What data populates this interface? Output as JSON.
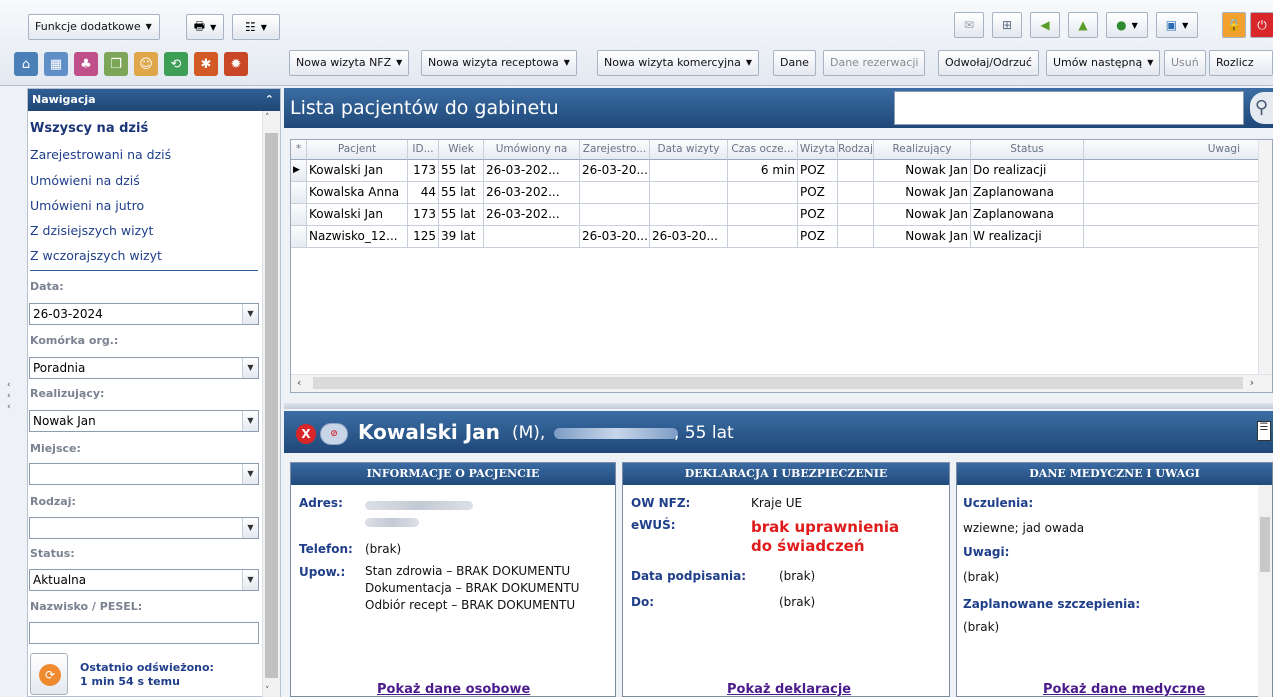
{
  "toolbar": {
    "additional_functions": "Funkcje dodatkowe",
    "buttons": {
      "nowa_nfz": "Nowa wizyta NFZ",
      "nowa_receptowa": "Nowa wizyta receptowa",
      "nowa_komercyjna": "Nowa wizyta komercyjna",
      "dane": "Dane",
      "dane_rezerwacji": "Dane rezerwacji",
      "odwolaj": "Odwołaj/Odrzuć",
      "umow_nastepna": "Umów następną",
      "usun": "Usuń",
      "rozlicz": "Rozlicz"
    }
  },
  "navigation": {
    "title": "Nawigacja",
    "items": [
      {
        "label": "Wszyscy na dziś",
        "active": true
      },
      {
        "label": "Zarejestrowani na dziś"
      },
      {
        "label": "Umówieni na dziś"
      },
      {
        "label": "Umówieni na jutro"
      },
      {
        "label": "Z dzisiejszych wizyt"
      },
      {
        "label": "Z wczorajszych wizyt"
      }
    ],
    "filters": {
      "data_label": "Data:",
      "data_value": "26-03-2024",
      "komorka_label": "Komórka org.:",
      "komorka_value": "Poradnia",
      "realizujacy_label": "Realizujący:",
      "realizujacy_value": "Nowak Jan",
      "miejsce_label": "Miejsce:",
      "miejsce_value": "",
      "rodzaj_label": "Rodzaj:",
      "rodzaj_value": "",
      "status_label": "Status:",
      "status_value": "Aktualna",
      "nazwisko_label": "Nazwisko / PESEL:",
      "nazwisko_value": ""
    },
    "refresh_title": "Ostatnio odświeżono:",
    "refresh_time": "1 min 54 s temu"
  },
  "list": {
    "title": "Lista pacjentów do gabinetu",
    "search_value": "",
    "headers": [
      "*",
      "Pacjent",
      "ID...",
      "Wiek",
      "Umówiony na",
      "Zarejestro...",
      "Data wizyty",
      "Czas ocze...",
      "Wizyta",
      "Rodzaj",
      "Realizujący",
      "Status",
      "Uwagi"
    ],
    "rows": [
      [
        "Kowalski Jan",
        "173",
        "55 lat",
        "26-03-202...",
        "26-03-20...",
        "",
        "6 min",
        "POZ",
        "",
        "Nowak Jan",
        "Do realizacji",
        ""
      ],
      [
        "Kowalska Anna",
        "44",
        "55 lat",
        "26-03-202...",
        "",
        "",
        "",
        "POZ",
        "",
        "Nowak Jan",
        "Zaplanowana",
        ""
      ],
      [
        "Kowalski Jan",
        "173",
        "55 lat",
        "26-03-202...",
        "",
        "",
        "",
        "POZ",
        "",
        "Nowak Jan",
        "Zaplanowana",
        ""
      ],
      [
        "Nazwisko_12...",
        "125",
        "39 lat",
        "",
        "26-03-20...",
        "26-03-20...",
        "",
        "POZ",
        "",
        "Nowak Jan",
        "W realizacji",
        ""
      ]
    ]
  },
  "patient": {
    "name": "Kowalski Jan",
    "sex": "(M),",
    "age": ", 55 lat",
    "info_panel": {
      "title": "INFORMACJE O PACJENCIE",
      "adres_label": "Adres:",
      "telefon_label": "Telefon:",
      "telefon_value": "(brak)",
      "upow_label": "Upow.:",
      "upow_lines": [
        "Stan zdrowia – BRAK DOKUMENTU",
        "Dokumentacja – BRAK DOKUMENTU",
        "Odbiór recept – BRAK DOKUMENTU"
      ],
      "link": "Pokaż dane osobowe"
    },
    "decl_panel": {
      "title": "DEKLARACJA I UBEZPIECZENIE",
      "ow_label": "OW NFZ:",
      "ow_value": "Kraje UE",
      "ewus_label": "eWUŚ:",
      "ewus_line1": "brak uprawnienia",
      "ewus_line2": "do świadczeń",
      "data_label": "Data podpisania:",
      "data_value": "(brak)",
      "do_label": "Do:",
      "do_value": "(brak)",
      "link": "Pokaż deklaracje"
    },
    "med_panel": {
      "title": "DANE MEDYCZNE I UWAGI",
      "uczulenia_label": "Uczulenia:",
      "uczulenia_value": "wziewne; jad owada",
      "uwagi_label": "Uwagi:",
      "uwagi_value": "(brak)",
      "szczepienia_label": "Zaplanowane szczepienia:",
      "szczepienia_value": "(brak)",
      "link": "Pokaż dane medyczne"
    }
  },
  "colors": {
    "accent": "#2a5a92",
    "error": "#e01b1b",
    "link": "#1f3f8a"
  }
}
